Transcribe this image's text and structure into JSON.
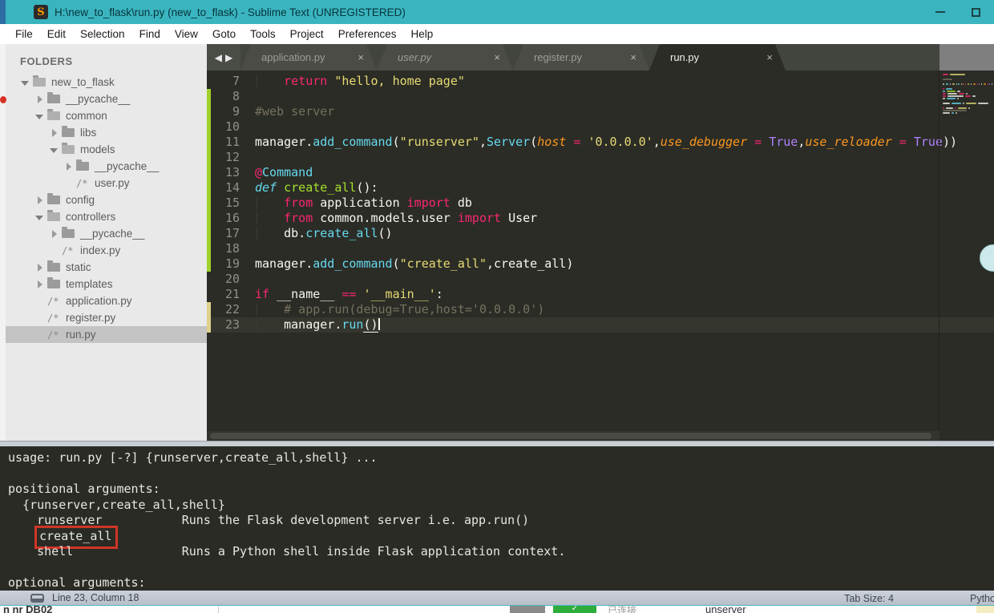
{
  "colors": {
    "titlebar": "#3ab5c0",
    "monokai_bg": "#2b2c26",
    "gutter_added": "#a0d02c",
    "gutter_modified": "#ddd08a",
    "redbox": "#cf3527"
  },
  "window": {
    "title": "H:\\new_to_flask\\run.py (new_to_flask) - Sublime Text (UNREGISTERED)",
    "logo_letter": "S",
    "controls": [
      "minimize",
      "maximize"
    ]
  },
  "menu": {
    "items": [
      "File",
      "Edit",
      "Selection",
      "Find",
      "View",
      "Goto",
      "Tools",
      "Project",
      "Preferences",
      "Help"
    ]
  },
  "sidebar": {
    "header": "FOLDERS",
    "tree": [
      {
        "indent": 0,
        "arrow": "down",
        "icon": "folder-open",
        "label": "new_to_flask",
        "selected": false
      },
      {
        "indent": 1,
        "arrow": "right",
        "icon": "folder",
        "label": "__pycache__",
        "selected": false
      },
      {
        "indent": 1,
        "arrow": "down",
        "icon": "folder-open",
        "label": "common",
        "selected": false
      },
      {
        "indent": 2,
        "arrow": "right",
        "icon": "folder",
        "label": "libs",
        "selected": false
      },
      {
        "indent": 2,
        "arrow": "down",
        "icon": "folder-open",
        "label": "models",
        "selected": false
      },
      {
        "indent": 3,
        "arrow": "right",
        "icon": "folder",
        "label": "__pycache__",
        "selected": false
      },
      {
        "indent": 3,
        "arrow": "none",
        "icon": "file",
        "label": "user.py",
        "selected": false
      },
      {
        "indent": 1,
        "arrow": "right",
        "icon": "folder",
        "label": "config",
        "selected": false
      },
      {
        "indent": 1,
        "arrow": "down",
        "icon": "folder-open",
        "label": "controllers",
        "selected": false
      },
      {
        "indent": 2,
        "arrow": "right",
        "icon": "folder",
        "label": "__pycache__",
        "selected": false
      },
      {
        "indent": 2,
        "arrow": "none",
        "icon": "file",
        "label": "index.py",
        "selected": false
      },
      {
        "indent": 1,
        "arrow": "right",
        "icon": "folder",
        "label": "static",
        "selected": false
      },
      {
        "indent": 1,
        "arrow": "right",
        "icon": "folder",
        "label": "templates",
        "selected": false
      },
      {
        "indent": 1,
        "arrow": "none",
        "icon": "file",
        "label": "application.py",
        "selected": false
      },
      {
        "indent": 1,
        "arrow": "none",
        "icon": "file",
        "label": "register.py",
        "selected": false
      },
      {
        "indent": 1,
        "arrow": "none",
        "icon": "file",
        "label": "run.py",
        "selected": true
      }
    ],
    "file_icon_glyph": "/*"
  },
  "tabbar": {
    "arrows": [
      "◀",
      "▶"
    ],
    "tabs": [
      {
        "label": "application.py",
        "close": "×",
        "active": false,
        "italic": false
      },
      {
        "label": "user.py",
        "close": "×",
        "active": false,
        "italic": true
      },
      {
        "label": "register.py",
        "close": "×",
        "active": false,
        "italic": false
      },
      {
        "label": "run.py",
        "close": "×",
        "active": true,
        "italic": false
      }
    ]
  },
  "editor": {
    "lines": [
      {
        "num": 7,
        "gutter": "none",
        "guide": true,
        "tokens": [
          {
            "t": "    ",
            "c": "fg"
          },
          {
            "t": "return",
            "c": "pink"
          },
          {
            "t": " ",
            "c": "fg"
          },
          {
            "t": "\"hello, home page\"",
            "c": "yellow"
          }
        ]
      },
      {
        "num": 8,
        "gutter": "green",
        "tokens": []
      },
      {
        "num": 9,
        "gutter": "green",
        "tokens": [
          {
            "t": "#web server",
            "c": "comment"
          }
        ]
      },
      {
        "num": 10,
        "gutter": "green",
        "tokens": []
      },
      {
        "num": 11,
        "gutter": "green",
        "tokens": [
          {
            "t": "manager.",
            "c": "fg"
          },
          {
            "t": "add_command",
            "c": "blue"
          },
          {
            "t": "(",
            "c": "fg"
          },
          {
            "t": "\"runserver\"",
            "c": "yellow"
          },
          {
            "t": ",",
            "c": "fg"
          },
          {
            "t": "Server",
            "c": "blue"
          },
          {
            "t": "(",
            "c": "fg"
          },
          {
            "t": "host",
            "c": "orange-i"
          },
          {
            "t": " ",
            "c": "fg"
          },
          {
            "t": "=",
            "c": "pink"
          },
          {
            "t": " ",
            "c": "fg"
          },
          {
            "t": "'0.0.0.0'",
            "c": "yellow"
          },
          {
            "t": ",",
            "c": "fg"
          },
          {
            "t": "use_debugger",
            "c": "orange-i"
          },
          {
            "t": " ",
            "c": "fg"
          },
          {
            "t": "=",
            "c": "pink"
          },
          {
            "t": " ",
            "c": "fg"
          },
          {
            "t": "True",
            "c": "purple"
          },
          {
            "t": ",",
            "c": "fg"
          },
          {
            "t": "use_reloader",
            "c": "orange-i"
          },
          {
            "t": " ",
            "c": "fg"
          },
          {
            "t": "=",
            "c": "pink"
          },
          {
            "t": " ",
            "c": "fg"
          },
          {
            "t": "True",
            "c": "purple"
          },
          {
            "t": "))",
            "c": "fg"
          }
        ]
      },
      {
        "num": 12,
        "gutter": "green",
        "tokens": []
      },
      {
        "num": 13,
        "gutter": "green",
        "tokens": [
          {
            "t": "@",
            "c": "pink"
          },
          {
            "t": "Command",
            "c": "blue"
          }
        ]
      },
      {
        "num": 14,
        "gutter": "green",
        "tokens": [
          {
            "t": "def",
            "c": "blue-i"
          },
          {
            "t": " ",
            "c": "fg"
          },
          {
            "t": "create_all",
            "c": "green"
          },
          {
            "t": "():",
            "c": "fg"
          }
        ]
      },
      {
        "num": 15,
        "gutter": "green",
        "guide": true,
        "tokens": [
          {
            "t": "    ",
            "c": "fg"
          },
          {
            "t": "from",
            "c": "pink"
          },
          {
            "t": " application ",
            "c": "fg"
          },
          {
            "t": "import",
            "c": "pink"
          },
          {
            "t": " db",
            "c": "fg"
          }
        ]
      },
      {
        "num": 16,
        "gutter": "green",
        "guide": true,
        "tokens": [
          {
            "t": "    ",
            "c": "fg"
          },
          {
            "t": "from",
            "c": "pink"
          },
          {
            "t": " common.models.user ",
            "c": "fg"
          },
          {
            "t": "import",
            "c": "pink"
          },
          {
            "t": " User",
            "c": "fg"
          }
        ]
      },
      {
        "num": 17,
        "gutter": "green",
        "guide": true,
        "tokens": [
          {
            "t": "    db.",
            "c": "fg"
          },
          {
            "t": "create_all",
            "c": "blue"
          },
          {
            "t": "()",
            "c": "fg"
          }
        ]
      },
      {
        "num": 18,
        "gutter": "green",
        "tokens": []
      },
      {
        "num": 19,
        "gutter": "green",
        "tokens": [
          {
            "t": "manager.",
            "c": "fg"
          },
          {
            "t": "add_command",
            "c": "blue"
          },
          {
            "t": "(",
            "c": "fg"
          },
          {
            "t": "\"create_all\"",
            "c": "yellow"
          },
          {
            "t": ",create_all)",
            "c": "fg"
          }
        ]
      },
      {
        "num": 20,
        "gutter": "none",
        "tokens": []
      },
      {
        "num": 21,
        "gutter": "none",
        "tokens": [
          {
            "t": "if",
            "c": "pink"
          },
          {
            "t": " __name__ ",
            "c": "fg"
          },
          {
            "t": "==",
            "c": "pink"
          },
          {
            "t": " ",
            "c": "fg"
          },
          {
            "t": "'__main__'",
            "c": "yellow"
          },
          {
            "t": ":",
            "c": "fg"
          }
        ]
      },
      {
        "num": 22,
        "gutter": "yellow",
        "guide": true,
        "tokens": [
          {
            "t": "    ",
            "c": "fg"
          },
          {
            "t": "# app.run(debug=True,host='0.0.0.0')",
            "c": "comment"
          }
        ]
      },
      {
        "num": 23,
        "gutter": "yellow",
        "guide": true,
        "current": true,
        "caret": true,
        "tokens": [
          {
            "t": "    manager.",
            "c": "fg"
          },
          {
            "t": "run",
            "c": "blue"
          },
          {
            "t": "()",
            "c": "fg",
            "u": true
          }
        ]
      }
    ]
  },
  "console": {
    "lines": [
      {
        "pre": "usage: run.py [-?] {runserver,create_all,shell} ..."
      },
      {
        "pre": ""
      },
      {
        "pre": "positional arguments:"
      },
      {
        "pre": "  {runserver,create_all,shell}"
      },
      {
        "pre": "    runserver           Runs the Flask development server i.e. app.run()"
      },
      {
        "pre": "    ",
        "box": "create_all"
      },
      {
        "pre": "    shell               Runs a Python shell inside Flask application context."
      },
      {
        "pre": ""
      },
      {
        "pre": "optional arguments:"
      }
    ]
  },
  "status": {
    "left": "Line 23, Column 18",
    "tab_size": "Tab Size: 4",
    "syntax": "Python"
  },
  "background_fragments": {
    "bottom_left": "n nr DB02",
    "green_badge_check": "✓",
    "chinese_label": "已连接",
    "partial_word": "unserver"
  }
}
